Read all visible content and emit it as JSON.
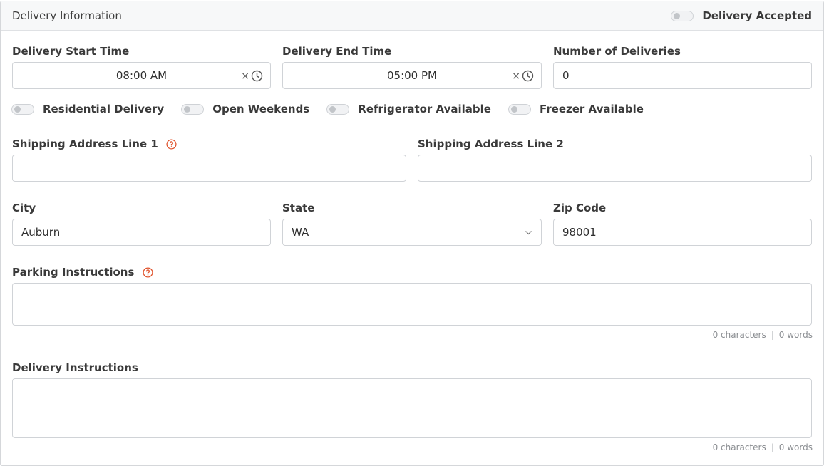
{
  "header": {
    "title": "Delivery Information",
    "toggle_label": "Delivery Accepted"
  },
  "fields": {
    "start_time": {
      "label": "Delivery Start Time",
      "value": "08:00 AM",
      "clear_glyph": "×"
    },
    "end_time": {
      "label": "Delivery End Time",
      "value": "05:00 PM",
      "clear_glyph": "×"
    },
    "num_deliveries": {
      "label": "Number of Deliveries",
      "value": "0"
    },
    "address1": {
      "label": "Shipping Address Line 1",
      "value": ""
    },
    "address2": {
      "label": "Shipping Address Line 2",
      "value": ""
    },
    "city": {
      "label": "City",
      "value": "Auburn"
    },
    "state": {
      "label": "State",
      "value": "WA"
    },
    "zip": {
      "label": "Zip Code",
      "value": "98001"
    },
    "parking": {
      "label": "Parking Instructions",
      "value": "",
      "chars": "0 characters",
      "sep": "|",
      "words": "0 words"
    },
    "delivery": {
      "label": "Delivery Instructions",
      "value": "",
      "chars": "0 characters",
      "sep": "|",
      "words": "0 words"
    }
  },
  "switches": {
    "residential": "Residential Delivery",
    "weekends": "Open Weekends",
    "refrigerator": "Refrigerator Available",
    "freezer": "Freezer Available"
  },
  "colors": {
    "help_icon": "#e0522b",
    "border": "#d0d3d7",
    "header_bg": "#f7f8f9"
  },
  "icons": {
    "clock": "clock-icon",
    "help": "help-circle-icon",
    "chevron": "chevron-down-icon"
  }
}
